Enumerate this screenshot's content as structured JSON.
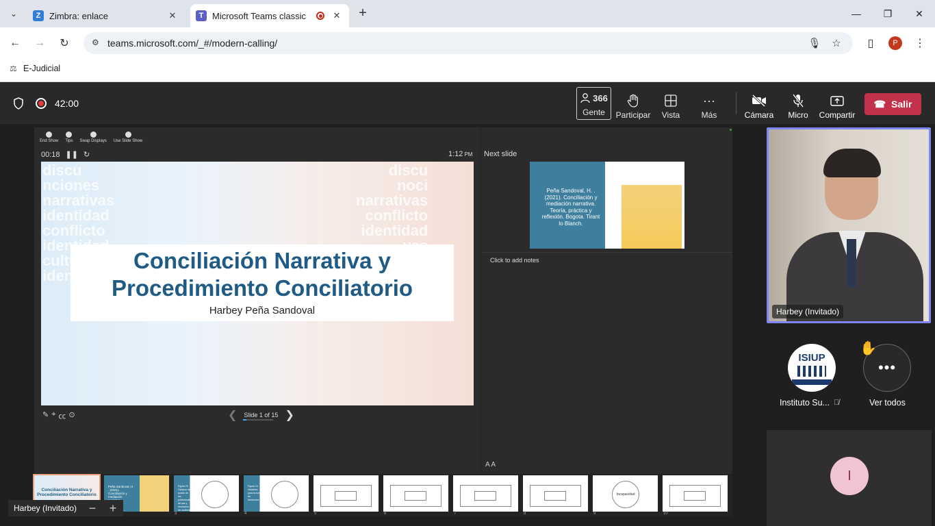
{
  "browser": {
    "tabs": [
      {
        "label": "Zimbra: enlace",
        "icon": "zimbra-icon",
        "favicon_letter": "Z"
      },
      {
        "label": "Microsoft Teams classic",
        "icon": "teams-icon",
        "favicon_letter": "T",
        "recording": true
      }
    ],
    "url": "teams.microsoft.com/_#/modern-calling/",
    "profile_initial": "P",
    "bookmarks": [
      {
        "label": "E-Judicial",
        "icon": "scales-icon"
      }
    ]
  },
  "meeting": {
    "timer": "42:00",
    "controls": {
      "people_count": "366",
      "people_label": "Gente",
      "raise_hand": "Participar",
      "view": "Vista",
      "more": "Más",
      "camera": "Cámara",
      "mic": "Micro",
      "share": "Compartir",
      "leave": "Salir"
    }
  },
  "presenter": {
    "tools": [
      {
        "label": "End Show",
        "icon": "close-icon"
      },
      {
        "label": "Tips",
        "icon": "info-icon"
      },
      {
        "label": "Swap Displays",
        "icon": "swap-icon"
      },
      {
        "label": "Use Slide Show",
        "icon": "slideshow-icon"
      }
    ],
    "elapsed": "00:18",
    "clock": "1:12",
    "clock_suffix": "PM",
    "slide": {
      "title_line1": "Conciliación Narrativa y",
      "title_line2": "Procedimiento Conciliatorio",
      "subtitle": "Harbey Peña Sandoval",
      "wordcloud_left": "discu\nnciones\nnarrativas\nidentidad\nconflicto\nidentidad\ncultura\nidenti",
      "wordcloud_right": "discu\nnoci\nnarrativas\nconflicto\nidentidad\nvas\nidentic\nculture"
    },
    "slide_counter": "Slide 1 of 15",
    "next_label": "Next slide",
    "next_slide_text": "Peña Sandoval, H. . (2021). Conciliación y mediación narrativa. Teoría, práctica y reflexión. Bogota. Tirant lo Blanch.",
    "notes_placeholder": "Click to add notes",
    "font_controls": "A  A",
    "thumbnails": [
      {
        "num": "1",
        "kind": "title",
        "text": "Conciliación Narrativa y Procedimiento Conciliatorio"
      },
      {
        "num": "2",
        "kind": "book",
        "text": "Peña Sandoval, H. . (2021). Conciliación y mediación narrativa."
      },
      {
        "num": "3",
        "kind": "blue-circles",
        "text": "Figura 20 Campos de acción de los profesionales de paz y resolución de conflictos"
      },
      {
        "num": "4",
        "kind": "blue-wheel",
        "text": "Figura 24 Variables para la toma de decisiones"
      },
      {
        "num": "5",
        "kind": "diagram",
        "text": ""
      },
      {
        "num": "6",
        "kind": "diagram",
        "text": ""
      },
      {
        "num": "7",
        "kind": "diagram",
        "text": ""
      },
      {
        "num": "8",
        "kind": "diagram",
        "text": ""
      },
      {
        "num": "9",
        "kind": "circle",
        "text": "Incapacidad"
      },
      {
        "num": "10",
        "kind": "diagram",
        "text": ""
      }
    ]
  },
  "stage": {
    "presenter_name": "Harbey (Invitado)",
    "zoom_label": "Harbey (Invitado)"
  },
  "participants": {
    "main_video_name": "Harbey (Invitado)",
    "avatars": [
      {
        "label": "Instituto Su...",
        "logo_text": "ISIUP",
        "muted": true
      },
      {
        "label": "Ver todos",
        "hand_raised": true
      }
    ],
    "tile_initial": "I"
  },
  "colors": {
    "leave": "#c4314b",
    "active_speaker": "#7f85f5",
    "slide_title": "#1f5b84",
    "teams_bar": "#292929"
  }
}
